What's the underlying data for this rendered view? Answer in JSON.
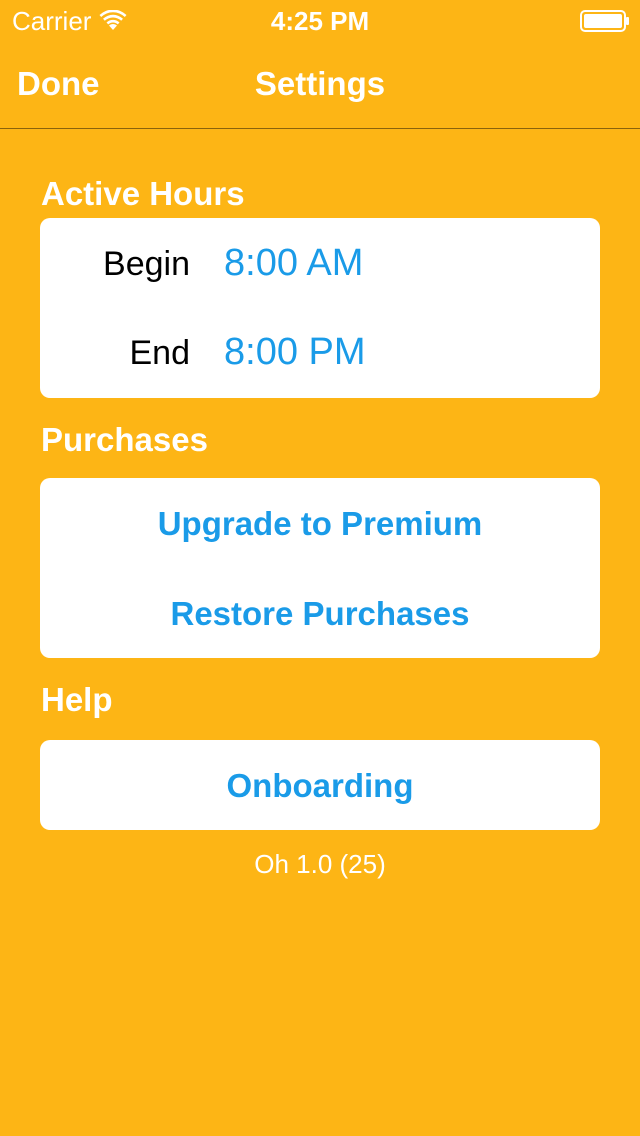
{
  "status_bar": {
    "carrier": "Carrier",
    "time": "4:25 PM",
    "wifi_icon": "wifi-icon",
    "battery_icon": "battery-icon"
  },
  "nav": {
    "done_label": "Done",
    "title": "Settings"
  },
  "active_hours": {
    "title": "Active Hours",
    "begin_label": "Begin",
    "begin_value": "8:00 AM",
    "end_label": "End",
    "end_value": "8:00 PM"
  },
  "purchases": {
    "title": "Purchases",
    "upgrade_label": "Upgrade to Premium",
    "restore_label": "Restore Purchases"
  },
  "help": {
    "title": "Help",
    "onboarding_label": "Onboarding"
  },
  "version": "Oh 1.0 (25)",
  "colors": {
    "background": "#FDB515",
    "accent": "#1A9BE8",
    "card": "#FFFFFF"
  }
}
